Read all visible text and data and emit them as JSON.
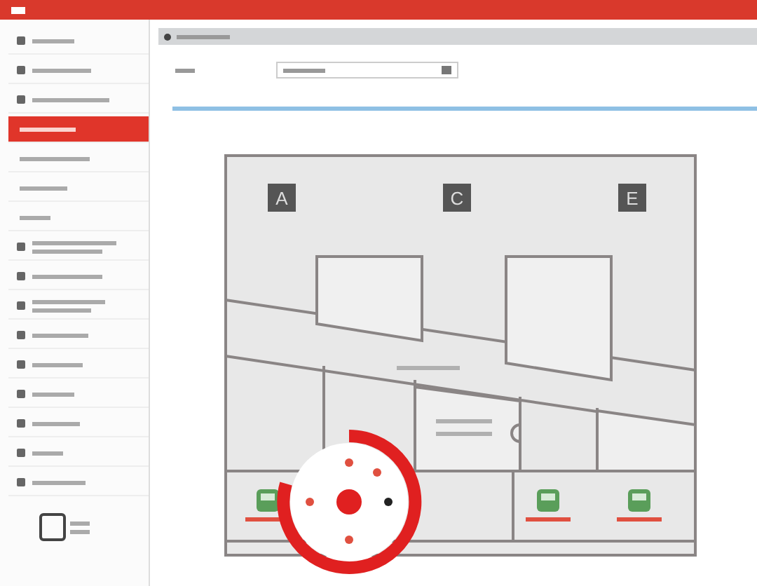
{
  "sidebar": {
    "items": [
      {
        "kind": "icon",
        "selected": false
      },
      {
        "kind": "icon",
        "selected": false
      },
      {
        "kind": "icon",
        "selected": false
      },
      {
        "kind": "sub",
        "selected": true
      },
      {
        "kind": "sub",
        "selected": false
      },
      {
        "kind": "sub",
        "selected": false
      },
      {
        "kind": "sub",
        "selected": false
      },
      {
        "kind": "wrapped",
        "selected": false
      },
      {
        "kind": "icon",
        "selected": false
      },
      {
        "kind": "wrapped",
        "selected": false
      },
      {
        "kind": "icon",
        "selected": false
      },
      {
        "kind": "icon",
        "selected": false
      },
      {
        "kind": "icon",
        "selected": false
      },
      {
        "kind": "icon",
        "selected": false
      },
      {
        "kind": "icon",
        "selected": false
      },
      {
        "kind": "icon",
        "selected": false
      }
    ]
  },
  "map": {
    "zones": [
      {
        "label": "A"
      },
      {
        "label": "C"
      },
      {
        "label": "E"
      }
    ],
    "vehicles": [
      {
        "kind": "vehicle",
        "color": "#5a9e5a"
      },
      {
        "kind": "vehicle",
        "color": "#5a9e5a"
      },
      {
        "kind": "vehicle",
        "color": "#5a9e5a"
      }
    ],
    "radial_menu": {
      "expanded": true,
      "options": [
        {
          "kind": "up"
        },
        {
          "kind": "right"
        },
        {
          "kind": "down"
        },
        {
          "kind": "left"
        },
        {
          "kind": "up-right"
        }
      ]
    }
  }
}
